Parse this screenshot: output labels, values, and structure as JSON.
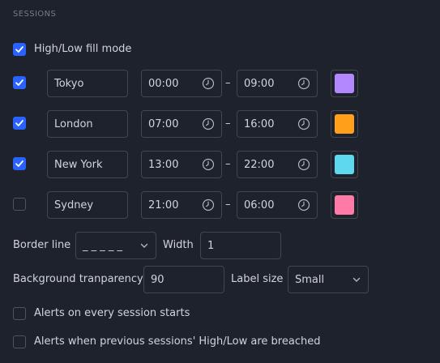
{
  "section_title": "SESSIONS",
  "fill_mode": {
    "label": "High/Low fill mode",
    "checked": true
  },
  "sessions": [
    {
      "enabled": true,
      "name": "Tokyo",
      "start": "00:00",
      "end": "09:00",
      "color": "#b388ff"
    },
    {
      "enabled": true,
      "name": "London",
      "start": "07:00",
      "end": "16:00",
      "color": "#ff9f1a"
    },
    {
      "enabled": true,
      "name": "New York",
      "start": "13:00",
      "end": "22:00",
      "color": "#5ed8ee"
    },
    {
      "enabled": false,
      "name": "Sydney",
      "start": "21:00",
      "end": "06:00",
      "color": "#ff7aa6"
    }
  ],
  "separator": "–",
  "border_line": {
    "label": "Border line",
    "value": "_ _ _ _ _"
  },
  "width": {
    "label": "Width",
    "value": "1"
  },
  "background_transparency": {
    "label": "Background tranparency",
    "value": "90"
  },
  "label_size": {
    "label": "Label size",
    "value": "Small"
  },
  "alerts": [
    {
      "label": "Alerts on every session starts",
      "checked": false
    },
    {
      "label": "Alerts when previous sessions' High/Low are breached",
      "checked": false
    }
  ]
}
